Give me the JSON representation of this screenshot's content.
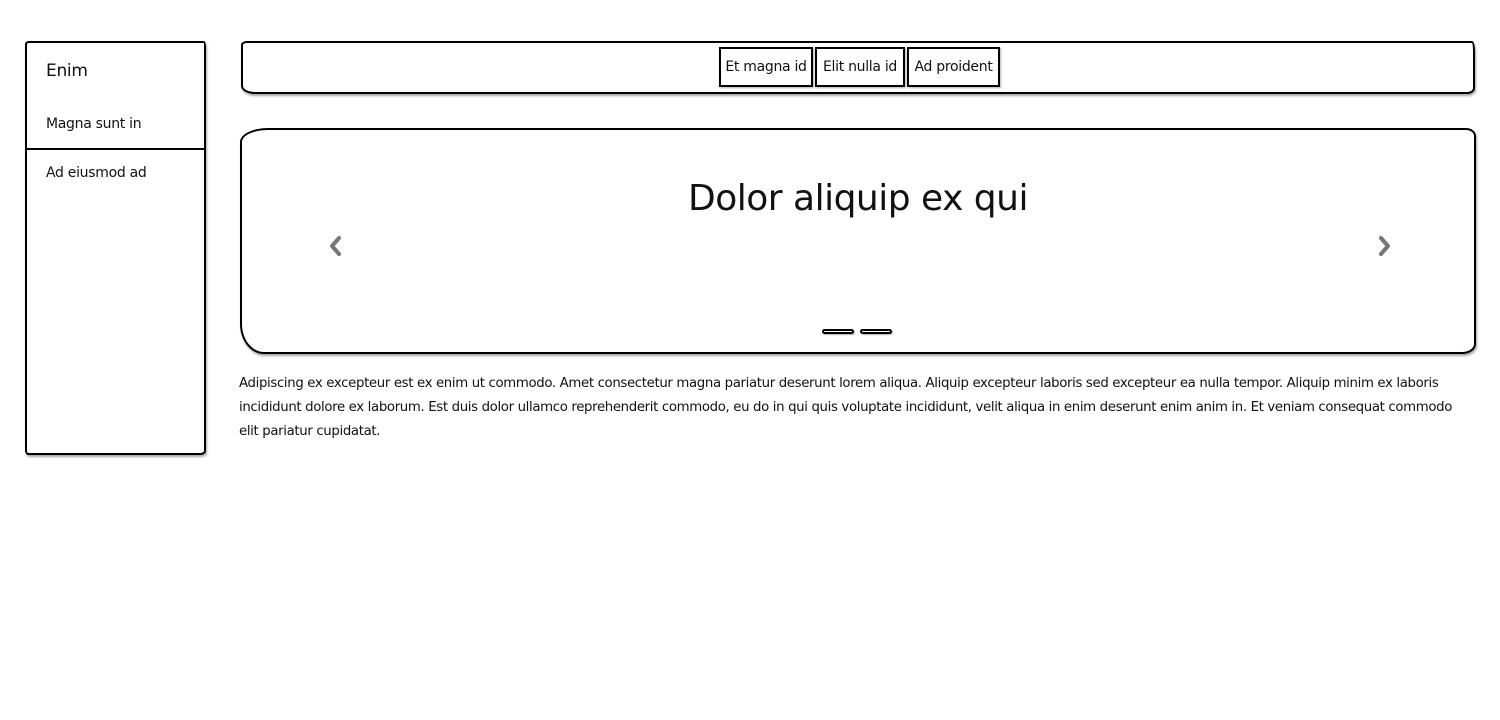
{
  "sidebar": {
    "title": "Enim",
    "items": [
      {
        "label": "Magna sunt in"
      },
      {
        "label": "Ad eiusmod ad"
      }
    ]
  },
  "navbar": {
    "tabs": [
      {
        "label": "Et magna id"
      },
      {
        "label": "Elit nulla id"
      },
      {
        "label": "Ad proident"
      }
    ]
  },
  "carousel": {
    "title": "Dolor aliquip ex qui",
    "prev_icon": "chevron-left-icon",
    "next_icon": "chevron-right-icon",
    "slide_count": 2,
    "arrow_color": "#777777"
  },
  "content": {
    "paragraph": "Adipiscing ex excepteur est ex enim ut commodo. Amet consectetur magna pariatur deserunt lorem aliqua. Aliquip excepteur laboris sed excepteur ea nulla tempor. Aliquip minim ex laboris incididunt dolore ex laborum. Est duis dolor ullamco reprehenderit commodo, eu do in qui quis voluptate incididunt, velit aliqua in enim deserunt enim anim in. Et veniam consequat commodo elit pariatur cupidatat."
  }
}
